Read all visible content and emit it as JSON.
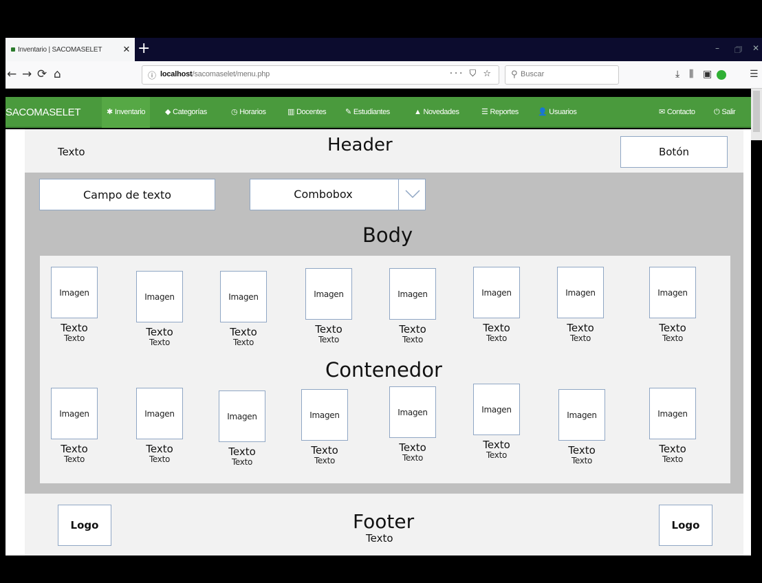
{
  "browser": {
    "tab_title": "Inventario | SACOMASELET",
    "tab_close": "✕",
    "new_tab": "+",
    "window_controls": [
      "–",
      "🗇",
      "✕"
    ],
    "url_host": "localhost",
    "url_path": "/sacomaselet/menu.php",
    "url_actions": "··· ⛉ ☆",
    "search_placeholder": "Buscar",
    "back": "←",
    "forward": "→",
    "reload": "⟳",
    "home": "⌂",
    "toolbar_icons": [
      "⤓",
      "⫼",
      "▣",
      "☰"
    ]
  },
  "site_nav": {
    "brand": "SACOMASELET",
    "items": [
      {
        "icon": "✱",
        "label": "Inventario",
        "active": true
      },
      {
        "icon": "◆",
        "label": "Categorías"
      },
      {
        "icon": "◷",
        "label": "Horarios"
      },
      {
        "icon": "▥",
        "label": "Docentes"
      },
      {
        "icon": "✎",
        "label": "Estudiantes"
      },
      {
        "icon": "▲",
        "label": "Novedades"
      },
      {
        "icon": "☰",
        "label": "Reportes"
      },
      {
        "icon": "👤",
        "label": "Usuarios"
      }
    ],
    "right_items": [
      {
        "icon": "✉",
        "label": "Contacto"
      },
      {
        "icon": "⏻",
        "label": "Salir"
      }
    ],
    "color": "#4a9a3d"
  },
  "header": {
    "title": "Header",
    "text": "Texto",
    "button": "Botón"
  },
  "body": {
    "title": "Body",
    "text_field": "Campo de texto",
    "combobox": "Combobox"
  },
  "container": {
    "title": "Contenedor",
    "cards": [
      {
        "image": "Imagen",
        "text": "Texto",
        "subtext": "Texto"
      },
      {
        "image": "Imagen",
        "text": "Texto",
        "subtext": "Texto"
      },
      {
        "image": "Imagen",
        "text": "Texto",
        "subtext": "Texto"
      },
      {
        "image": "Imagen",
        "text": "Texto",
        "subtext": "Texto"
      },
      {
        "image": "Imagen",
        "text": "Texto",
        "subtext": "Texto"
      },
      {
        "image": "Imagen",
        "text": "Texto",
        "subtext": "Texto"
      },
      {
        "image": "Imagen",
        "text": "Texto",
        "subtext": "Texto"
      },
      {
        "image": "Imagen",
        "text": "Texto",
        "subtext": "Texto"
      },
      {
        "image": "Imagen",
        "text": "Texto",
        "subtext": "Texto"
      },
      {
        "image": "Imagen",
        "text": "Texto",
        "subtext": "Texto"
      },
      {
        "image": "Imagen",
        "text": "Texto",
        "subtext": "Texto"
      },
      {
        "image": "Imagen",
        "text": "Texto",
        "subtext": "Texto"
      },
      {
        "image": "Imagen",
        "text": "Texto",
        "subtext": "Texto"
      },
      {
        "image": "Imagen",
        "text": "Texto",
        "subtext": "Texto"
      },
      {
        "image": "Imagen",
        "text": "Texto",
        "subtext": "Texto"
      },
      {
        "image": "Imagen",
        "text": "Texto",
        "subtext": "Texto"
      }
    ]
  },
  "footer": {
    "title": "Footer",
    "text": "Texto",
    "logo_left": "Logo",
    "logo_right": "Logo"
  }
}
